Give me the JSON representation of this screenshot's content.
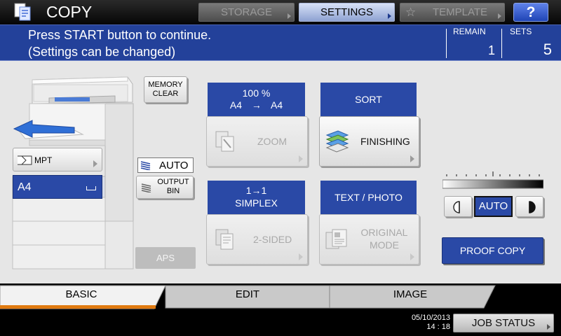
{
  "header": {
    "title": "COPY",
    "storage_label": "STORAGE",
    "settings_label": "SETTINGS",
    "template_label": "TEMPLATE",
    "help_label": "?"
  },
  "message": {
    "line1": "Press START button to continue.",
    "line2": "(Settings can be changed)",
    "remain_label": "REMAIN",
    "remain_value": "1",
    "sets_label": "SETS",
    "sets_value": "5"
  },
  "paper": {
    "memory_clear_line1": "MEMORY",
    "memory_clear_line2": "CLEAR",
    "mpt_label": "MPT",
    "tray_label": "A4",
    "output_auto_label": "AUTO",
    "output_bin_line1": "OUTPUT",
    "output_bin_line2": "BIN",
    "aps_label": "APS"
  },
  "functions": {
    "zoom_percent": "100 %",
    "zoom_from": "A4",
    "zoom_arrow": "→",
    "zoom_to": "A4",
    "zoom_label": "ZOOM",
    "finishing_status": "SORT",
    "finishing_label": "FINISHING",
    "duplex_status_line1": "1→1",
    "duplex_status_line2": "SIMPLEX",
    "duplex_label": "2-SIDED",
    "original_status": "TEXT / PHOTO",
    "original_label_line1": "ORIGINAL",
    "original_label_line2": "MODE"
  },
  "density": {
    "auto_label": "AUTO",
    "proof_copy_label": "PROOF COPY"
  },
  "tabs": {
    "basic": "BASIC",
    "edit": "EDIT",
    "image": "IMAGE"
  },
  "footer": {
    "date": "05/10/2013",
    "time": "14 : 18",
    "job_status_label": "JOB STATUS"
  },
  "colors": {
    "header_blue": "#23419a",
    "panel_blue": "#2a49a6",
    "active_tab_accent": "#e07a10"
  }
}
